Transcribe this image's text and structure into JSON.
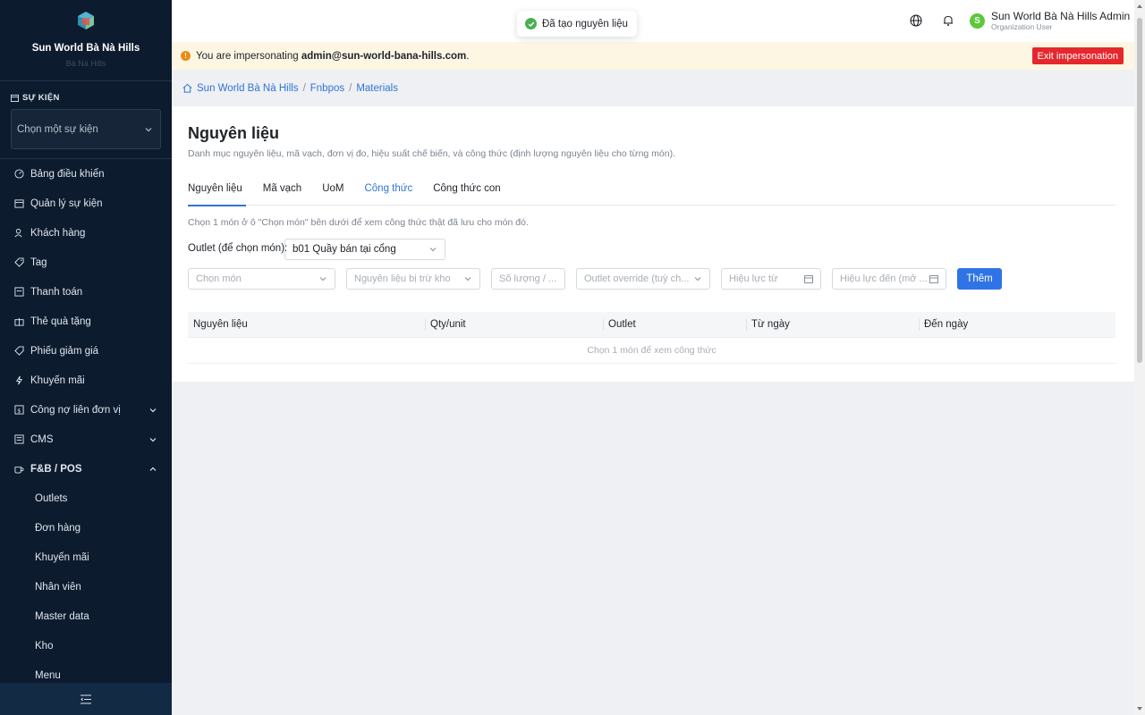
{
  "sidebar": {
    "org_name": "Sun World Bà Nà Hills",
    "org_sub": "Bà Nà Hills",
    "event_section": "SỰ KIỆN",
    "event_placeholder": "Chọn một sự kiện",
    "items": [
      {
        "label": "Bảng điều khiển",
        "icon": "dashboard-icon"
      },
      {
        "label": "Quản lý sự kiện",
        "icon": "calendar-icon"
      },
      {
        "label": "Khách hàng",
        "icon": "user-icon"
      },
      {
        "label": "Tag",
        "icon": "tag-icon"
      },
      {
        "label": "Thanh toán",
        "icon": "payment-icon"
      },
      {
        "label": "Thẻ quà tặng",
        "icon": "gift-icon"
      },
      {
        "label": "Phiếu giảm giá",
        "icon": "coupon-icon"
      },
      {
        "label": "Khuyến mãi",
        "icon": "lightning-icon"
      },
      {
        "label": "Công nợ liên đơn vị",
        "icon": "ledger-icon"
      },
      {
        "label": "CMS",
        "icon": "cms-icon"
      },
      {
        "label": "F&B / POS",
        "icon": "coffee-icon"
      }
    ],
    "fnb_sub": [
      "Outlets",
      "Đơn hàng",
      "Khuyến mãi",
      "Nhân viên",
      "Master data",
      "Kho",
      "Menu"
    ]
  },
  "topbar": {
    "toast": "Đã tạo nguyên liệu",
    "user_initial": "S",
    "user_name": "Sun World Bà Nà Hills Admin",
    "user_role": "Organization User"
  },
  "banner": {
    "prefix": "You are impersonating",
    "email": "admin@sun-world-bana-hills.com",
    "suffix": ".",
    "exit_label": "Exit impersonation"
  },
  "breadcrumb": [
    "Sun World Bà Nà Hills",
    "Fnbpos",
    "Materials"
  ],
  "page": {
    "title": "Nguyên liệu",
    "description": "Danh mục nguyên liệu, mã vạch, đơn vị đo, hiệu suất chế biến, và công thức (định lượng nguyên liệu cho từng món).",
    "tabs": [
      "Nguyên liệu",
      "Mã vạch",
      "UoM",
      "Công thức",
      "Công thức con"
    ],
    "hint": "Chọn 1 món ở ô \"Chọn món\" bên dưới để xem công thức thật đã lưu cho món đó.",
    "outlet_label": "Outlet (để chọn món):",
    "outlet_value": "b01 Quầy bán tại cổng",
    "fields": {
      "dish": "Chọn món",
      "material": "Nguyên liệu bị trừ kho",
      "qty": "Số lượng / ...",
      "outlet_override": "Outlet override (tuỳ ch...",
      "valid_from": "Hiệu lực từ",
      "valid_to": "Hiệu lực đến (mở ..."
    },
    "add_label": "Thêm",
    "table": {
      "columns": [
        "Nguyên liệu",
        "Qty/unit",
        "Outlet",
        "Từ ngày",
        "Đến ngày"
      ],
      "empty": "Chọn 1 món để xem công thức"
    }
  }
}
